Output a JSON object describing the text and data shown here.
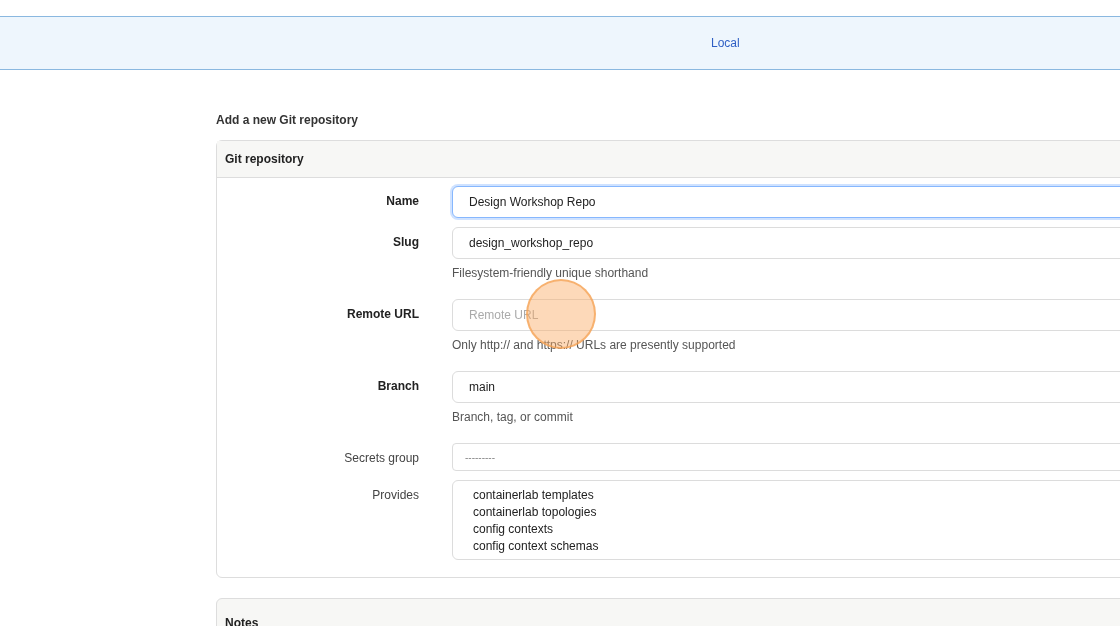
{
  "tabs": [
    {
      "label": "Local",
      "selected": true
    }
  ],
  "page_title": "Add a new Git repository",
  "form": {
    "title": "Git repository",
    "fields": [
      {
        "kind": "text",
        "label": "Name",
        "required": true,
        "value": "Design Workshop Repo",
        "focused": true
      },
      {
        "kind": "text",
        "label": "Slug",
        "required": true,
        "value": "design_workshop_repo",
        "focused": false,
        "help": "Filesystem-friendly unique shorthand"
      },
      {
        "kind": "text",
        "label": "Remote URL",
        "required": true,
        "placeholder": "Remote URL",
        "focused": false,
        "help": "Only http:// and https:// URLs are presently supported"
      },
      {
        "kind": "text",
        "label": "Branch",
        "required": true,
        "value": "main",
        "focused": false,
        "help": "Branch, tag, or commit"
      },
      {
        "kind": "select",
        "label": "Secrets group",
        "required": false,
        "placeholder": "---------"
      },
      {
        "kind": "multiselect",
        "label": "Provides",
        "required": false,
        "options": [
          "containerlab templates",
          "containerlab topologies",
          "config contexts",
          "config context schemas"
        ]
      }
    ]
  },
  "notes_section": {
    "title": "Notes"
  }
}
